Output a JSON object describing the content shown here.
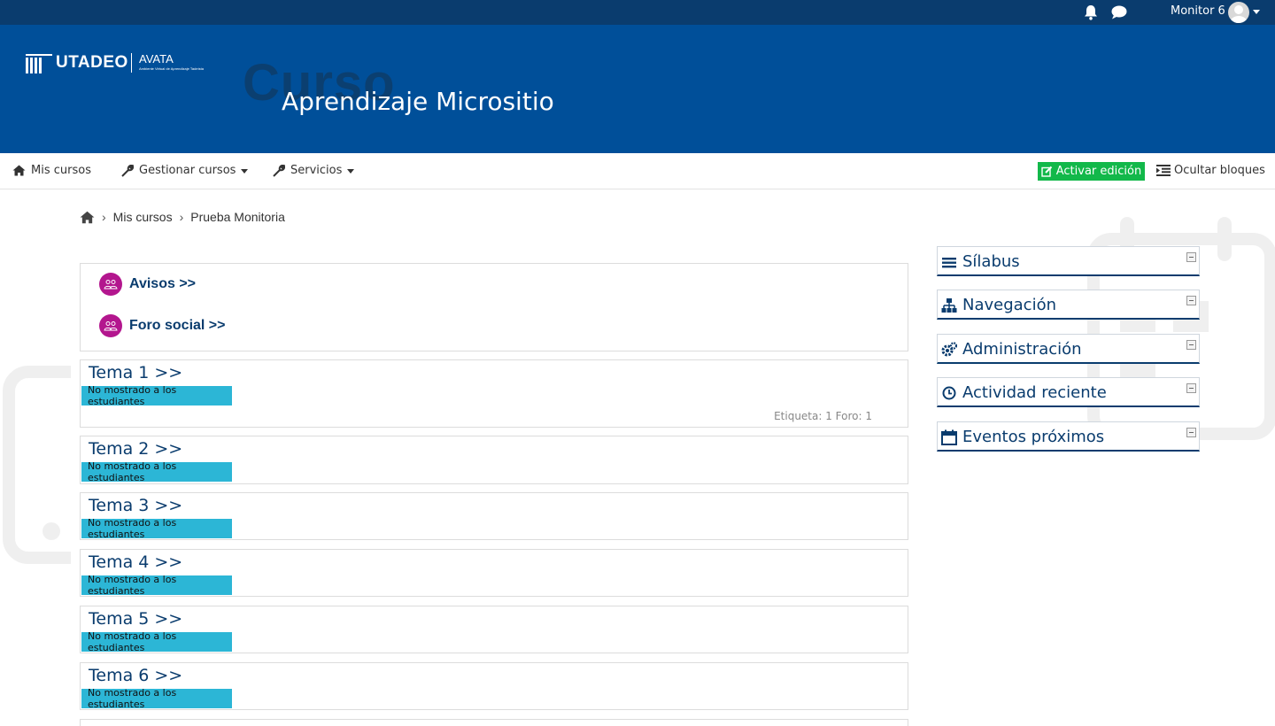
{
  "topbar": {
    "user_name": "Monitor 6",
    "icons": [
      "bell-icon",
      "chat-icon",
      "avatar",
      "chevron-down-icon"
    ]
  },
  "hero": {
    "logo_text": "UTADEO",
    "logo_sub": "AVATA",
    "logo_subtitle": "Ambiente Virtual de Aprendizaje Tadeísta",
    "ghost_text": "Curso",
    "course_title": "Aprendizaje Micrositio"
  },
  "navbar": {
    "mis_cursos": "Mis cursos",
    "gestionar": "Gestionar cursos",
    "servicios": "Servicios",
    "activar_edicion": "Activar edición",
    "ocultar_bloques": "Ocultar bloques"
  },
  "breadcrumb": {
    "items": [
      "Mis cursos",
      "Prueba Monitoria"
    ]
  },
  "intro": {
    "avisos": "Avisos >>",
    "foro": "Foro social >>"
  },
  "topics": [
    {
      "title": "Tema 1 >>",
      "badge": "No mostrado a los estudiantes",
      "summary": "Etiqueta: 1  Foro: 1"
    },
    {
      "title": "Tema 2 >>",
      "badge": "No mostrado a los estudiantes"
    },
    {
      "title": "Tema 3 >>",
      "badge": "No mostrado a los estudiantes"
    },
    {
      "title": "Tema 4 >>",
      "badge": "No mostrado a los estudiantes"
    },
    {
      "title": "Tema 5 >>",
      "badge": "No mostrado a los estudiantes"
    },
    {
      "title": "Tema 6 >>",
      "badge": "No mostrado a los estudiantes"
    }
  ],
  "blocks": [
    {
      "title": "Sílabus",
      "icon": "list-icon"
    },
    {
      "title": "Navegación",
      "icon": "sitemap-icon"
    },
    {
      "title": "Administración",
      "icon": "cogs-icon"
    },
    {
      "title": "Actividad reciente",
      "icon": "clock-icon"
    },
    {
      "title": "Eventos próximos",
      "icon": "calendar-icon"
    }
  ],
  "colors": {
    "topbar": "#0a3c6e",
    "hero": "#004f99",
    "edit_button": "#12b84a",
    "badge": "#2cb6d6",
    "module_icon": "#b3168e"
  }
}
